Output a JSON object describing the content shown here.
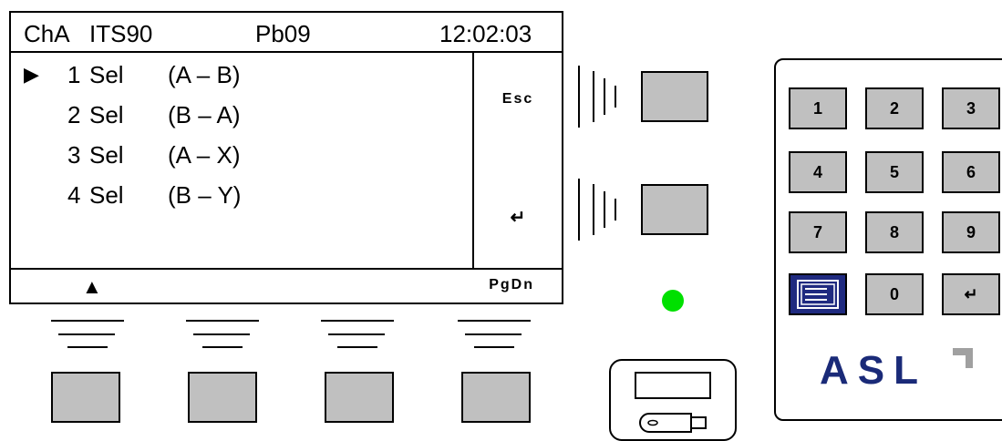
{
  "screen": {
    "status": {
      "channel": "ChA",
      "scale": "ITS90",
      "probe": "Pb09",
      "time": "12:02:03"
    },
    "menu": {
      "cursor": "▶",
      "items": [
        {
          "num": "1",
          "label": "Sel",
          "range": "(A – B)"
        },
        {
          "num": "2",
          "label": "Sel",
          "range": "(B – A)"
        },
        {
          "num": "3",
          "label": "Sel",
          "range": "(A – X)"
        },
        {
          "num": "4",
          "label": "Sel",
          "range": "(B – Y)"
        }
      ]
    },
    "side": {
      "esc": "Esc",
      "enter": "↵"
    },
    "softkeys": {
      "up": "▲",
      "pgdn": "PgDn"
    }
  },
  "keypad": {
    "keys": [
      "1",
      "2",
      "3",
      "4",
      "5",
      "6",
      "7",
      "8",
      "9",
      "0",
      "↵"
    ],
    "menu_key_icon": "menu-icon",
    "logo": "ASL"
  },
  "led": {
    "color": "#00e000",
    "state": "on"
  },
  "usb": {
    "icon": "usb-stick-icon"
  },
  "colors": {
    "button_face": "#c0c0c0",
    "logo_blue": "#1a2a78",
    "menu_key": "#1f2a80"
  }
}
